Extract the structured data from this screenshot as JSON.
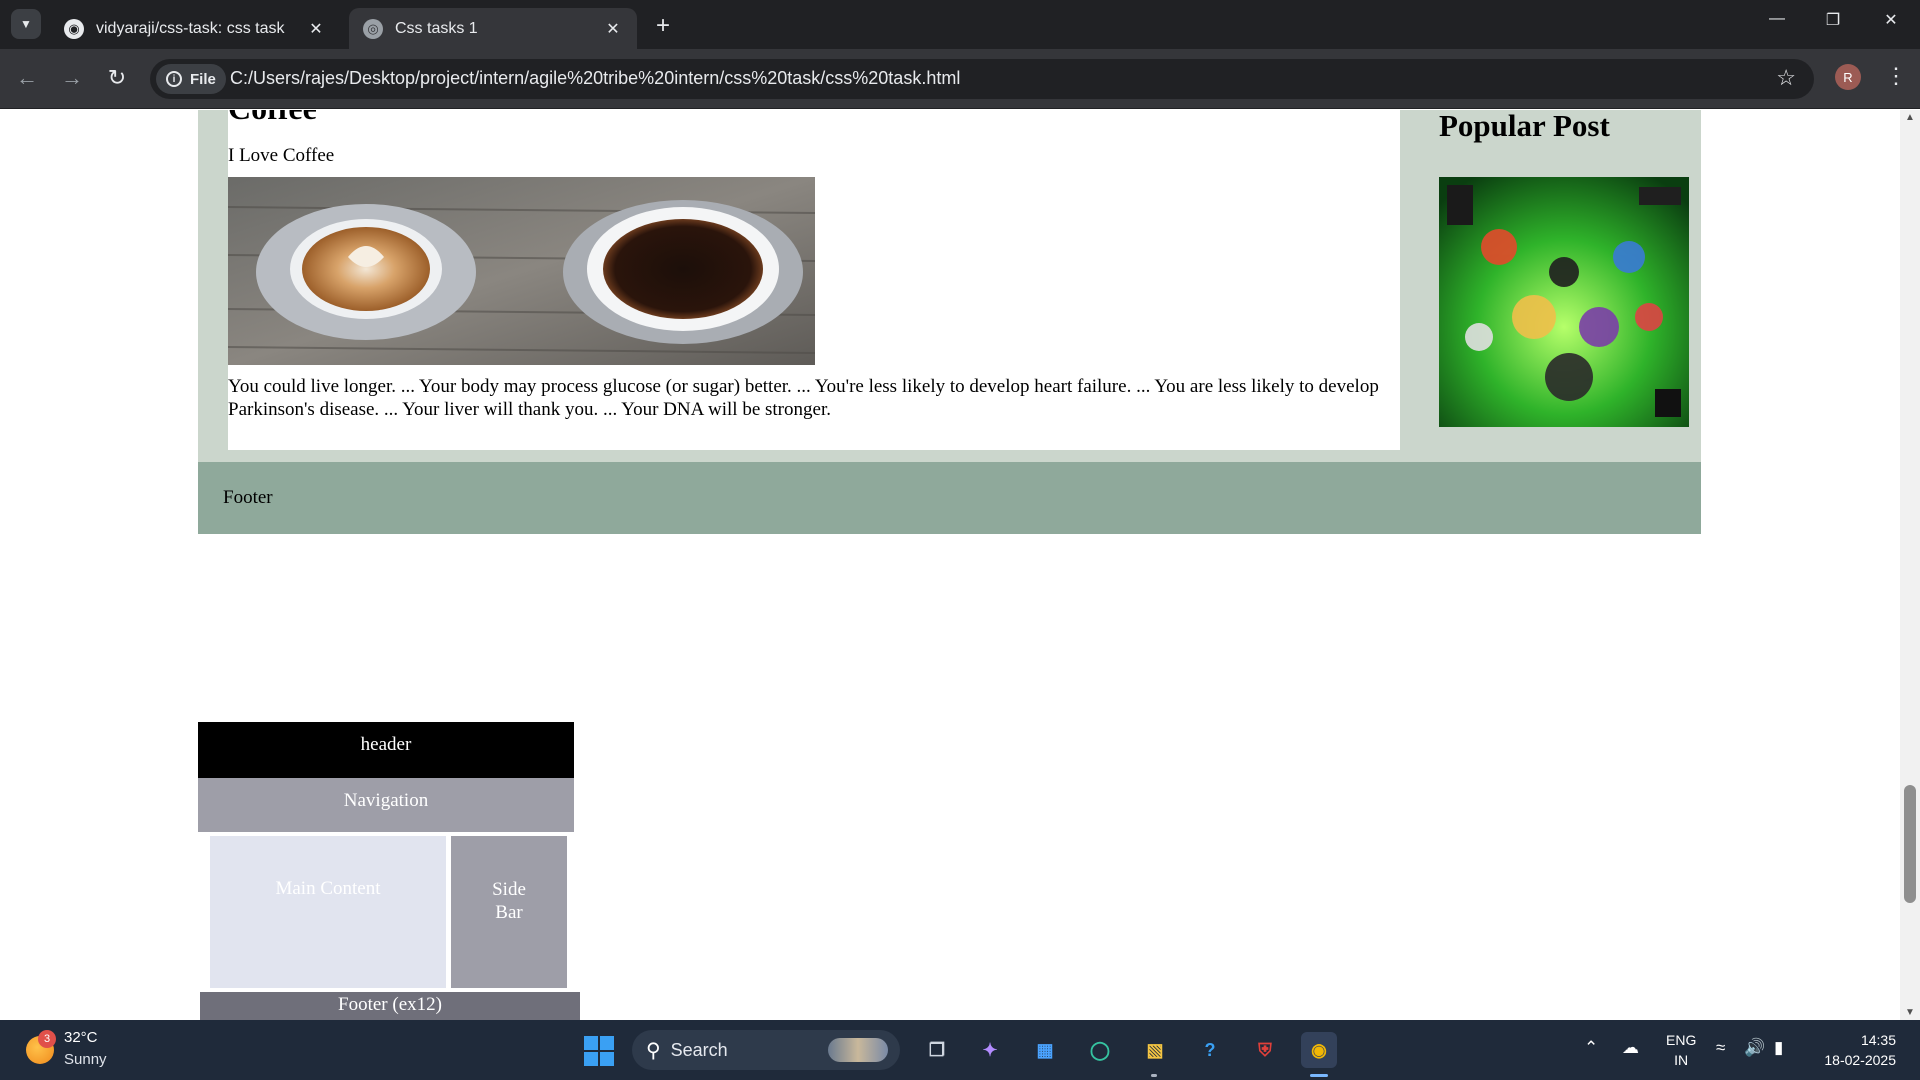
{
  "browser": {
    "tabs": [
      {
        "title": "vidyaraji/css-task: css task",
        "favicon": "github-icon"
      },
      {
        "title": "Css tasks 1",
        "favicon": "globe-icon"
      }
    ],
    "security_chip": "File",
    "url": "C:/Users/rajes/Desktop/project/intern/agile%20tribe%20intern/css%20task/css%20task.html",
    "profile_initial": "R"
  },
  "page": {
    "article": {
      "heading": "Coffee",
      "subtitle": "I Love Coffee",
      "body": "You could live longer. ... Your body may process glucose (or sugar) better. ... You're less likely to develop heart failure. ... You are less likely to develop Parkinson's disease. ... Your liver will thank you. ... Your DNA will be stronger."
    },
    "sidebar": {
      "title": "Popular Post"
    },
    "footer": "Footer",
    "demo": {
      "header": "header",
      "navigation": "Navigation",
      "main": "Main Content",
      "side1": "Side",
      "side2": "Bar",
      "footer": "Footer (ex12)"
    }
  },
  "taskbar": {
    "weather": {
      "temp": "32°C",
      "condition": "Sunny",
      "badge": "3"
    },
    "search_label": "Search",
    "language": [
      "ENG",
      "IN"
    ],
    "time": "14:35",
    "date": "18-02-2025"
  },
  "colors": {
    "layout_bg": "#cbd6cc",
    "footer_bg": "#8fa99b",
    "chrome_dark": "#202124",
    "taskbar": "#1f2a3a"
  }
}
